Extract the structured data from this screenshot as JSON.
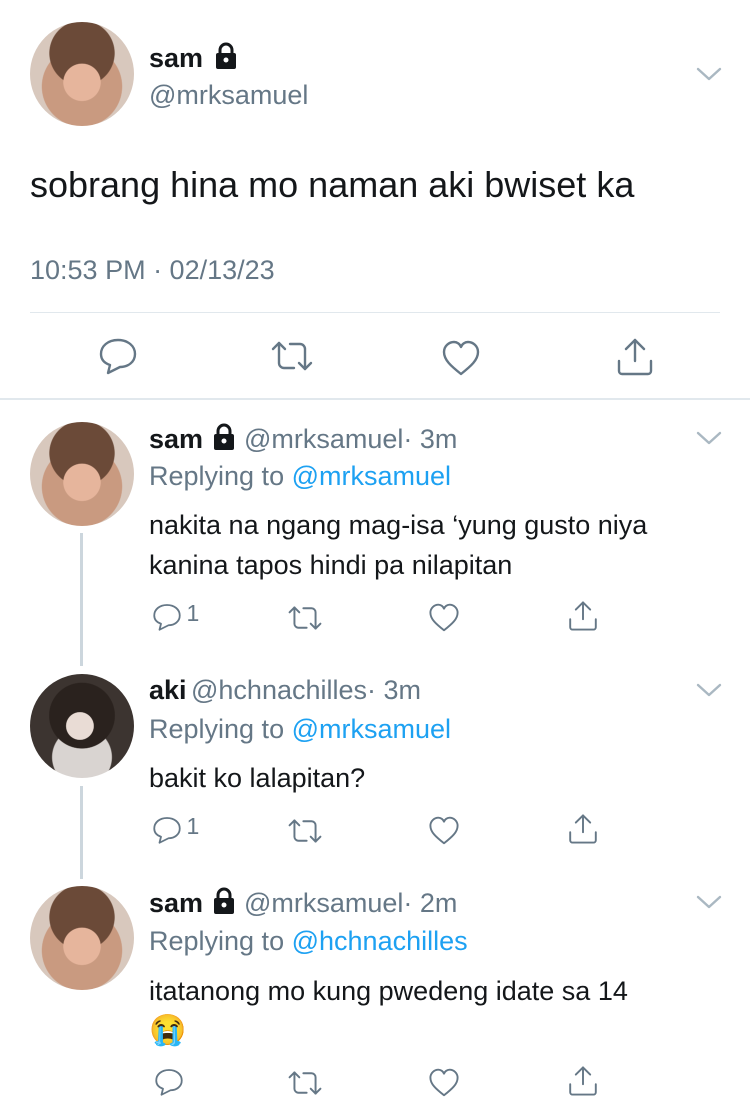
{
  "main_tweet": {
    "display_name": "sam",
    "handle": "@mrksamuel",
    "text": "sobrang hina mo naman aki bwiset ka",
    "timestamp": "10:53 PM · 02/13/23"
  },
  "replies": [
    {
      "display_name": "sam",
      "handle": "@mrksamuel",
      "time": "· 3m",
      "replying_label": "Replying to",
      "replying_to": "@mrksamuel",
      "text_line1": "nakita na ngang mag-isa ‘yung gusto niya",
      "text_line2": "kanina tapos hindi pa nilapitan",
      "reply_count": "1"
    },
    {
      "display_name": "aki",
      "handle": "@hchnachilles",
      "time": "· 3m",
      "replying_label": "Replying to",
      "replying_to": "@mrksamuel",
      "text_line1": "bakit ko lalapitan?",
      "reply_count": "1"
    },
    {
      "display_name": "sam",
      "handle": "@mrksamuel",
      "time": "· 2m",
      "replying_label": "Replying to",
      "replying_to": "@hchnachilles",
      "text_line1": "itatanong mo kung pwedeng idate sa 14",
      "emoji": "😭"
    }
  ],
  "colors": {
    "link": "#1da1f2",
    "muted": "#657786",
    "text": "#14171a"
  },
  "icons": [
    "lock-icon",
    "chevron-down-icon",
    "reply-icon",
    "retweet-icon",
    "like-icon",
    "share-icon"
  ]
}
